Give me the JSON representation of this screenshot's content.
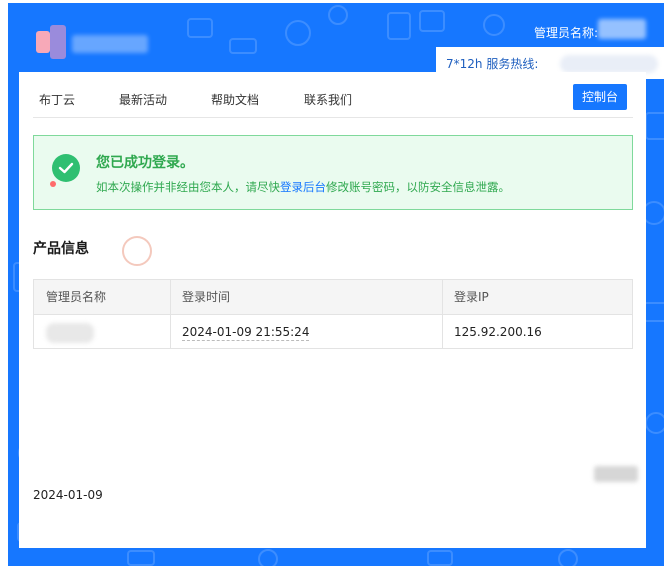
{
  "header": {
    "admin_label": "管理员名称:",
    "hotline_label": "7*12h 服务热线:"
  },
  "nav": {
    "items": [
      {
        "label": "布丁云"
      },
      {
        "label": "最新活动"
      },
      {
        "label": "帮助文档"
      },
      {
        "label": "联系我们"
      }
    ],
    "console_label": "控制台"
  },
  "alert": {
    "title": "您已成功登录。",
    "desc_before": "如本次操作并非经由您本人，请尽快",
    "desc_link": "登录后台",
    "desc_after": "修改账号密码，以防安全信息泄露。",
    "icon": "check-circle-icon"
  },
  "product": {
    "title": "产品信息"
  },
  "table": {
    "headers": [
      "管理员名称",
      "登录时间",
      "登录IP"
    ],
    "rows": [
      {
        "name": "",
        "time": "2024-01-09 21:55:24",
        "ip": "125.92.200.16"
      }
    ]
  },
  "footer": {
    "date": "2024-01-09"
  },
  "colors": {
    "brand": "#1677ff",
    "success": "#2fbf71",
    "success_bg": "#eafbef"
  }
}
